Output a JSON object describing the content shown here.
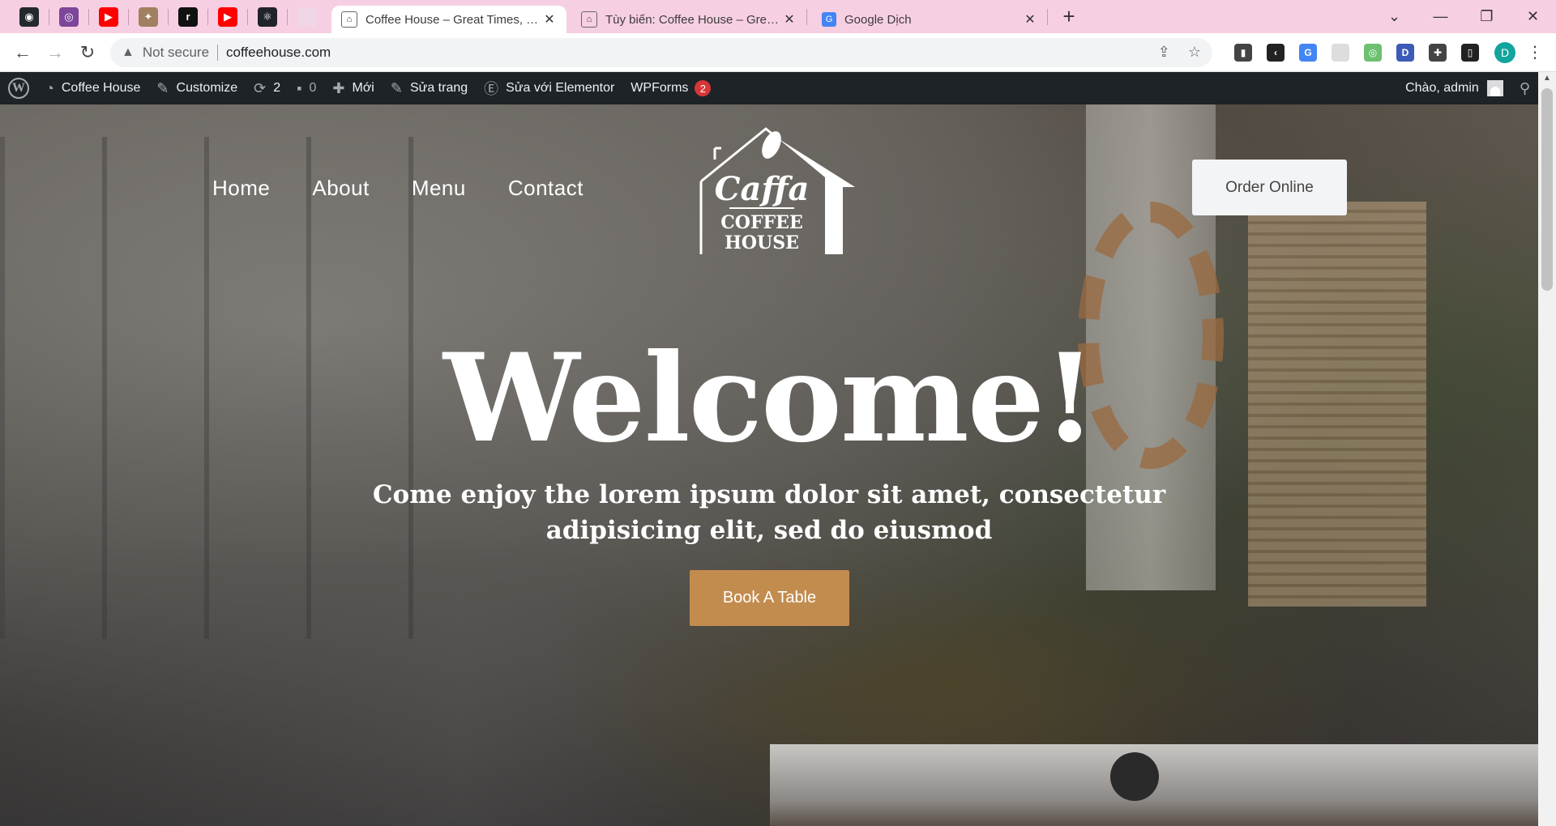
{
  "browser": {
    "pinned_tabs": [
      {
        "icon": "github-icon",
        "color": "#24292e",
        "glyph": "◉"
      },
      {
        "icon": "tor-icon",
        "color": "#7d4698",
        "glyph": "◎"
      },
      {
        "icon": "youtube-icon",
        "color": "#ff0000",
        "glyph": "▶"
      },
      {
        "icon": "bird-icon",
        "color": "#a08060",
        "glyph": "✦"
      },
      {
        "icon": "r-app-icon",
        "color": "#111111",
        "glyph": "r"
      },
      {
        "icon": "youtube-icon",
        "color": "#ff0000",
        "glyph": "▶"
      },
      {
        "icon": "react-icon",
        "color": "#20232a",
        "glyph": "⚛"
      },
      {
        "icon": "blank-tab-icon",
        "color": "#f0d6e6",
        "glyph": ""
      }
    ],
    "tabs": [
      {
        "title": "Coffee House – Great Times, Good Coffee",
        "active": true
      },
      {
        "title": "Tùy biến: Coffee House – Great Times, Good Coffee",
        "active": false
      },
      {
        "title": "Google Dịch",
        "active": false
      }
    ],
    "address": {
      "security_label": "Not secure",
      "url": "coffeehouse.com"
    },
    "profile_initial": "D",
    "extensions": [
      {
        "icon": "phone-ext-icon",
        "color": "#444444",
        "glyph": "▮"
      },
      {
        "icon": "chevron-ext-icon",
        "color": "#222222",
        "glyph": "‹"
      },
      {
        "icon": "translate-ext-icon",
        "color": "#4285f4",
        "glyph": "G"
      },
      {
        "icon": "blank-ext-icon",
        "color": "#dddddd",
        "glyph": ""
      },
      {
        "icon": "color-ext-icon",
        "color": "#6cc070",
        "glyph": "◎"
      },
      {
        "icon": "d-ext-icon",
        "color": "#3b5bb7",
        "glyph": "D"
      },
      {
        "icon": "puzzle-icon",
        "color": "#444444",
        "glyph": "✚"
      },
      {
        "icon": "sidepanel-icon",
        "color": "#222222",
        "glyph": "▯"
      }
    ]
  },
  "adminbar": {
    "site_name": "Coffee House",
    "customize": "Customize",
    "updates_count": "2",
    "comments_count": "0",
    "new_label": "Mới",
    "edit_page": "Sửa trang",
    "edit_elementor": "Sửa với Elementor",
    "wpforms": "WPForms",
    "wpforms_badge": "2",
    "greeting": "Chào, admin"
  },
  "site": {
    "nav": [
      "Home",
      "About",
      "Menu",
      "Contact"
    ],
    "logo": {
      "script": "Caffa",
      "line1": "COFFEE",
      "line2": "HOUSE"
    },
    "order_button": "Order Online",
    "headline": "Welcome!",
    "tagline_line1": "Come enjoy the lorem ipsum dolor sit amet, consectetur",
    "tagline_line2": "adipisicing elit, sed do eiusmod",
    "book_button": "Book A Table",
    "accent_color": "#c38c4f"
  }
}
